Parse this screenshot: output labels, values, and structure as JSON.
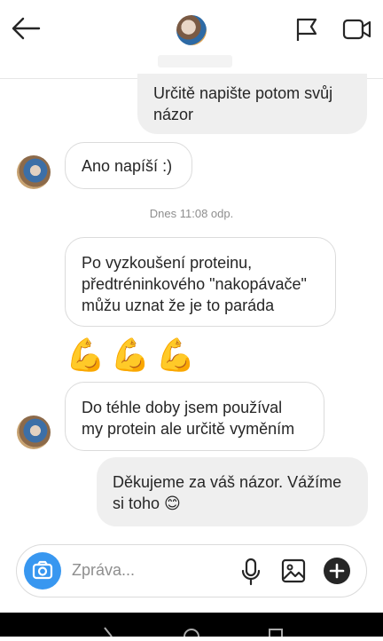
{
  "messages": {
    "out_1": "Určitě napište potom svůj názor",
    "in_1": "Ano napíší :)",
    "timestamp": "Dnes 11:08 odp.",
    "in_2": "Po vyzkoušení proteinu, předtréninkového \"nakopávače\" můžu uznat že je to paráda",
    "in_3": "Do téhle doby jsem používal my protein ale určitě vyměním",
    "out_2": "Děkujeme za váš názor. Vážíme si toho 😊"
  },
  "emoji": [
    "💪",
    "💪",
    "💪"
  ],
  "composer": {
    "placeholder": "Zpráva..."
  },
  "icons": {
    "header": [
      "back-arrow-icon",
      "flag-icon",
      "video-call-icon"
    ],
    "composer": [
      "camera-icon",
      "microphone-icon",
      "image-icon",
      "plus-icon"
    ]
  },
  "colors": {
    "accent": "#3897f0",
    "outgoing_bubble": "#efefef"
  }
}
